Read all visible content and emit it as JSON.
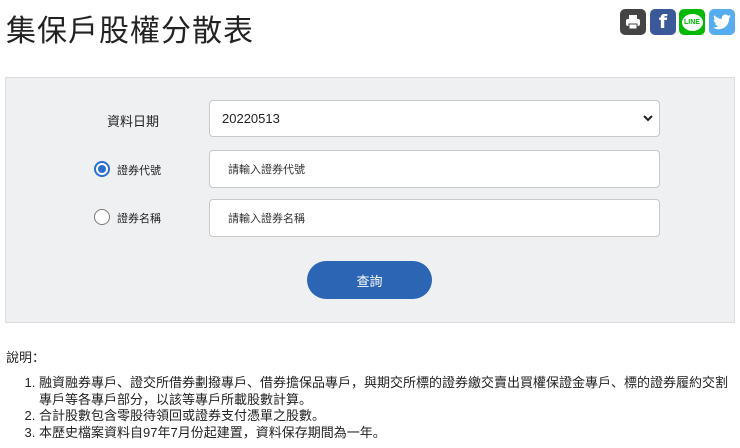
{
  "page": {
    "title": "集保戶股權分散表"
  },
  "share": [
    {
      "name": "print",
      "color": "#444444"
    },
    {
      "name": "facebook",
      "color": "#3b5998"
    },
    {
      "name": "line",
      "color": "#00b900",
      "label": "LINE"
    },
    {
      "name": "twitter",
      "color": "#55acee"
    }
  ],
  "form": {
    "date_label": "資料日期",
    "date_value": "20220513",
    "code_label": "證券代號",
    "code_placeholder": "請輸入證券代號",
    "code_selected": true,
    "name_label": "證券名稱",
    "name_placeholder": "請輸入證券名稱",
    "name_selected": false,
    "submit_label": "查詢"
  },
  "notes": {
    "heading": "說明：",
    "items": [
      "融資融券專戶、證交所借券劃撥專戶、借券擔保品專戶，與期交所標的證券繳交賣出買權保證金專戶、標的證券履約交割專戶等各專戶部分，以該等專戶所載股數計算。",
      "合計股數包含零股待領回或證券支付憑單之股數。",
      "本歷史檔案資料自97年7月份起建置，資料保存期間為一年。"
    ]
  }
}
